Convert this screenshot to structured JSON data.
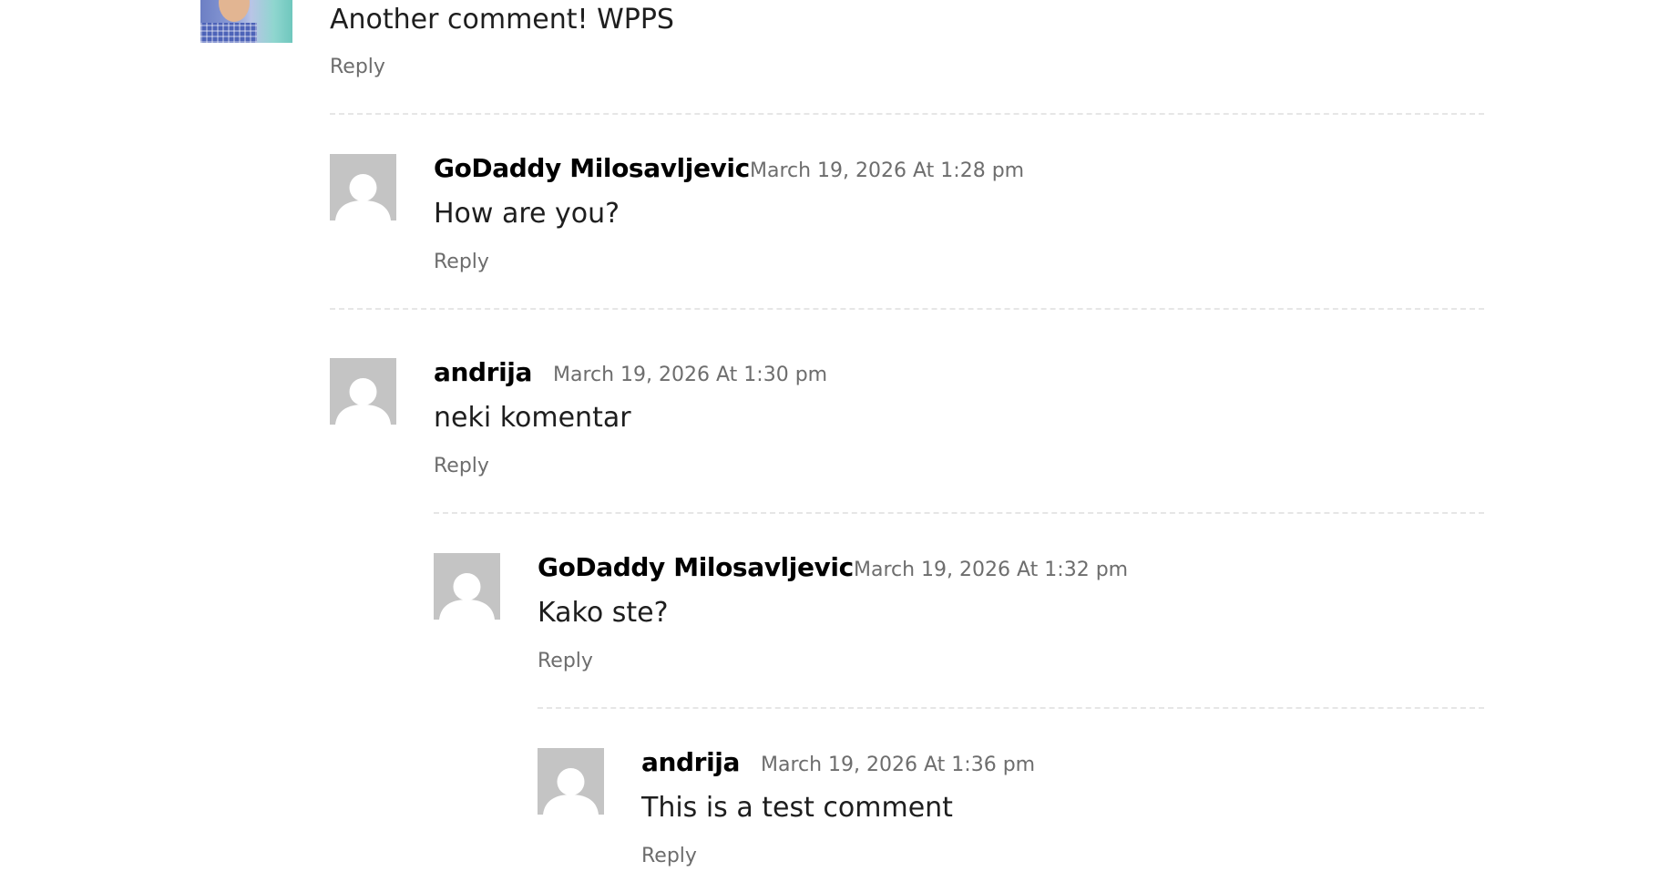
{
  "top_comment": {
    "text": "Another comment! WPPS",
    "reply_label": "Reply"
  },
  "comments": [
    {
      "author": "GoDaddy Milosavljevic",
      "date": "March 19, 2026 At 1:28 pm",
      "text": "How are you?",
      "reply_label": "Reply"
    },
    {
      "author": "andrija",
      "date": "March 19, 2026 At 1:30 pm",
      "text": "neki komentar",
      "reply_label": "Reply"
    },
    {
      "author": "GoDaddy Milosavljevic",
      "date": "March 19, 2026 At 1:32 pm",
      "text": "Kako ste?",
      "reply_label": "Reply"
    },
    {
      "author": "andrija",
      "date": "March 19, 2026 At 1:36 pm",
      "text": "This is a test comment",
      "reply_label": "Reply"
    }
  ],
  "icons": {
    "avatar": "default-person-avatar-icon",
    "top_avatar": "user-photo-avatar"
  },
  "colors": {
    "text": "#1e1e1e",
    "author": "#000000",
    "meta": "#6d6d6d",
    "avatar_bg": "#c4c4c4",
    "divider": "#e6e6e6"
  }
}
